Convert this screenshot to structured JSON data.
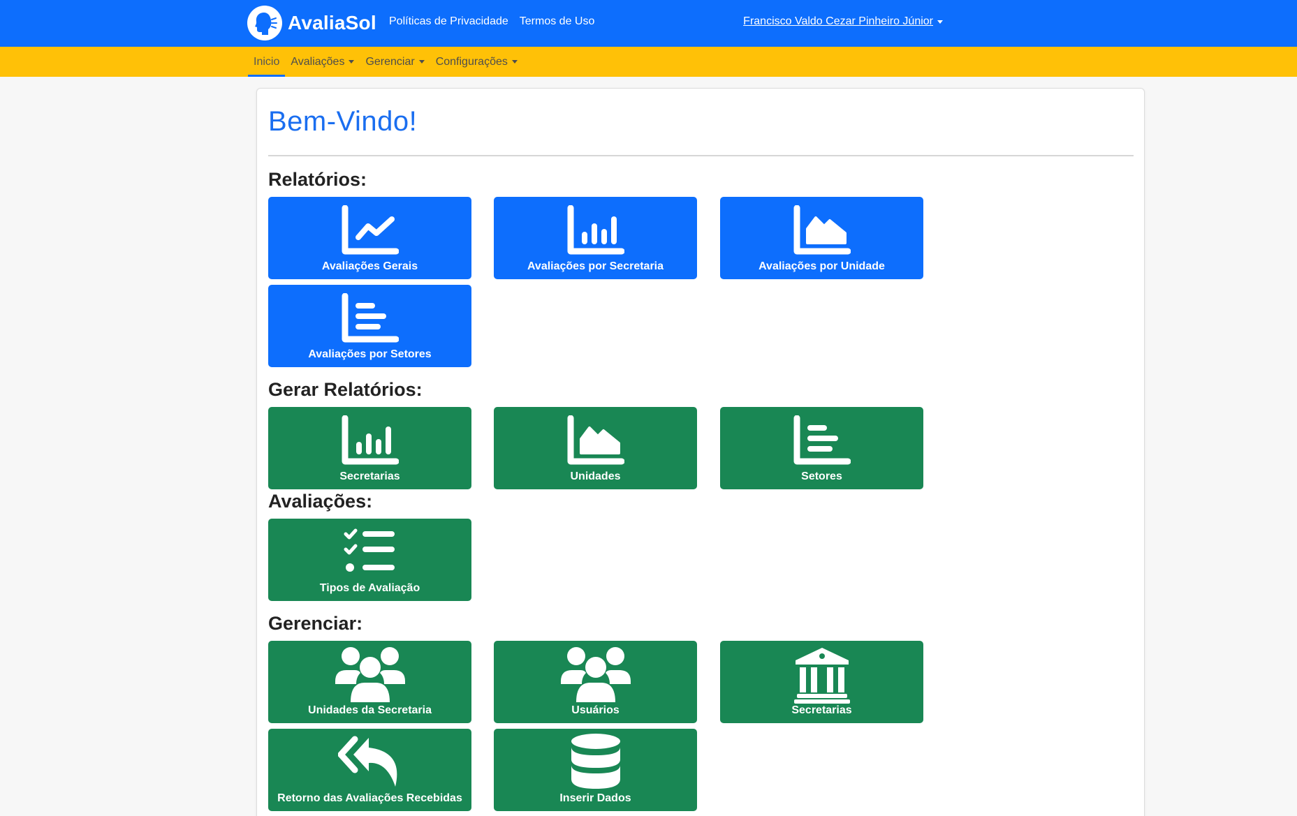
{
  "header": {
    "brand": "AvaliaSol",
    "links": [
      "Políticas de Privacidade",
      "Termos de Uso"
    ],
    "user": "Francisco Valdo Cezar Pinheiro Júnior"
  },
  "subnav": {
    "items": [
      "Inicio",
      "Avaliações",
      "Gerenciar",
      "Configurações"
    ]
  },
  "main": {
    "welcome": "Bem-Vindo!",
    "sections": {
      "relatorios": {
        "title": "Relatórios:",
        "tiles": [
          "Avaliações Gerais",
          "Avaliações por Secretaria",
          "Avaliações por Unidade",
          "Avaliações por Setores"
        ]
      },
      "gerar": {
        "title": "Gerar Relatórios:",
        "tiles": [
          "Secretarias",
          "Unidades",
          "Setores"
        ]
      },
      "avaliacoes": {
        "title": "Avaliações:",
        "tiles": [
          "Tipos de Avaliação"
        ]
      },
      "gerenciar": {
        "title": "Gerenciar:",
        "tiles": [
          "Unidades da Secretaria",
          "Usuários",
          "Secretarias",
          "Retorno das Avaliações Recebidas",
          "Inserir Dados"
        ]
      }
    }
  },
  "colors": {
    "primary": "#0d6efd",
    "warning": "#ffc107",
    "success": "#198754",
    "heading": "#1a6ef0"
  },
  "icons": {
    "brand": "speaking-head-icon",
    "line_chart": "chart-line-icon",
    "bar_chart": "chart-bar-icon",
    "area_chart": "chart-area-icon",
    "hbar_chart": "chart-hbar-icon",
    "checklist": "checklist-icon",
    "users": "users-icon",
    "building": "landmark-icon",
    "reply_all": "reply-all-icon",
    "database": "database-icon"
  }
}
